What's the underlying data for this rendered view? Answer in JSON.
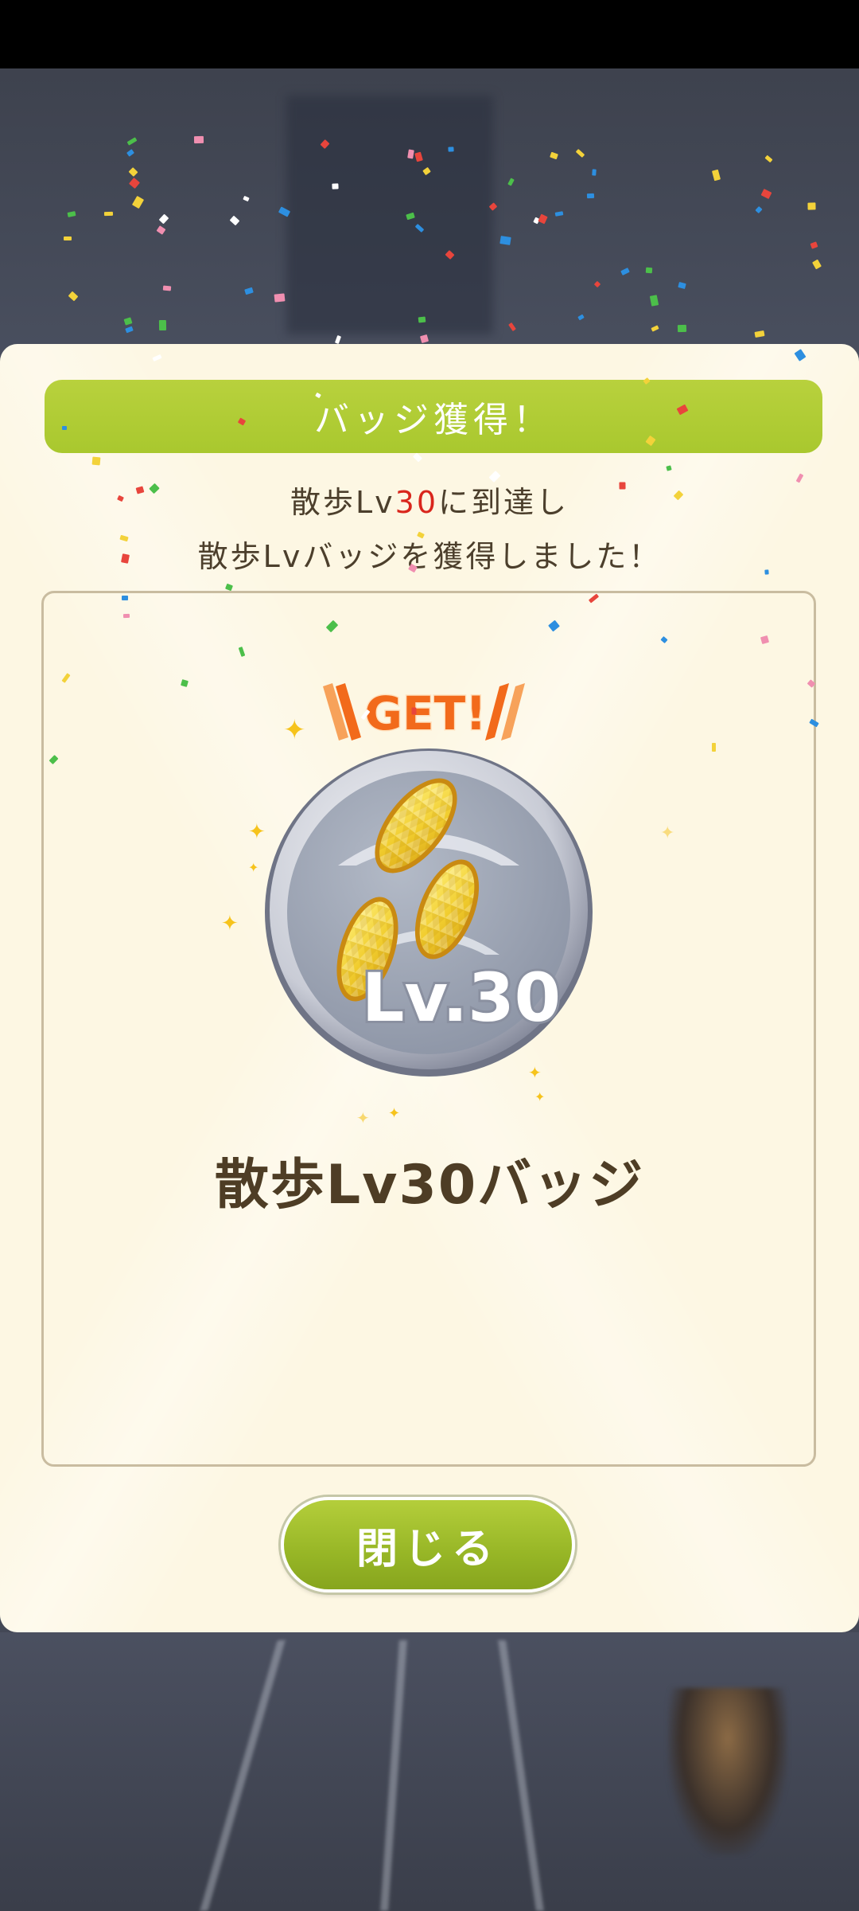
{
  "dialog": {
    "title": "バッジ獲得！",
    "message_line1_prefix": "散歩Lv",
    "message_line1_level": "30",
    "message_line1_suffix": "に到達し",
    "message_line2": "散歩Lvバッジを獲得しました！",
    "get_label": "GET!",
    "badge_level_text": "Lv.30",
    "badge_name": "散歩Lv30バッジ",
    "close_label": "閉じる"
  },
  "colors": {
    "accent_green": "#aac82f",
    "highlight_red": "#d9261c",
    "modal_background": "#fdf7e3",
    "get_orange": "#f26a1b"
  },
  "icons": {
    "badge": "footprints-badge-icon",
    "sparkle": "sparkle-icon"
  }
}
